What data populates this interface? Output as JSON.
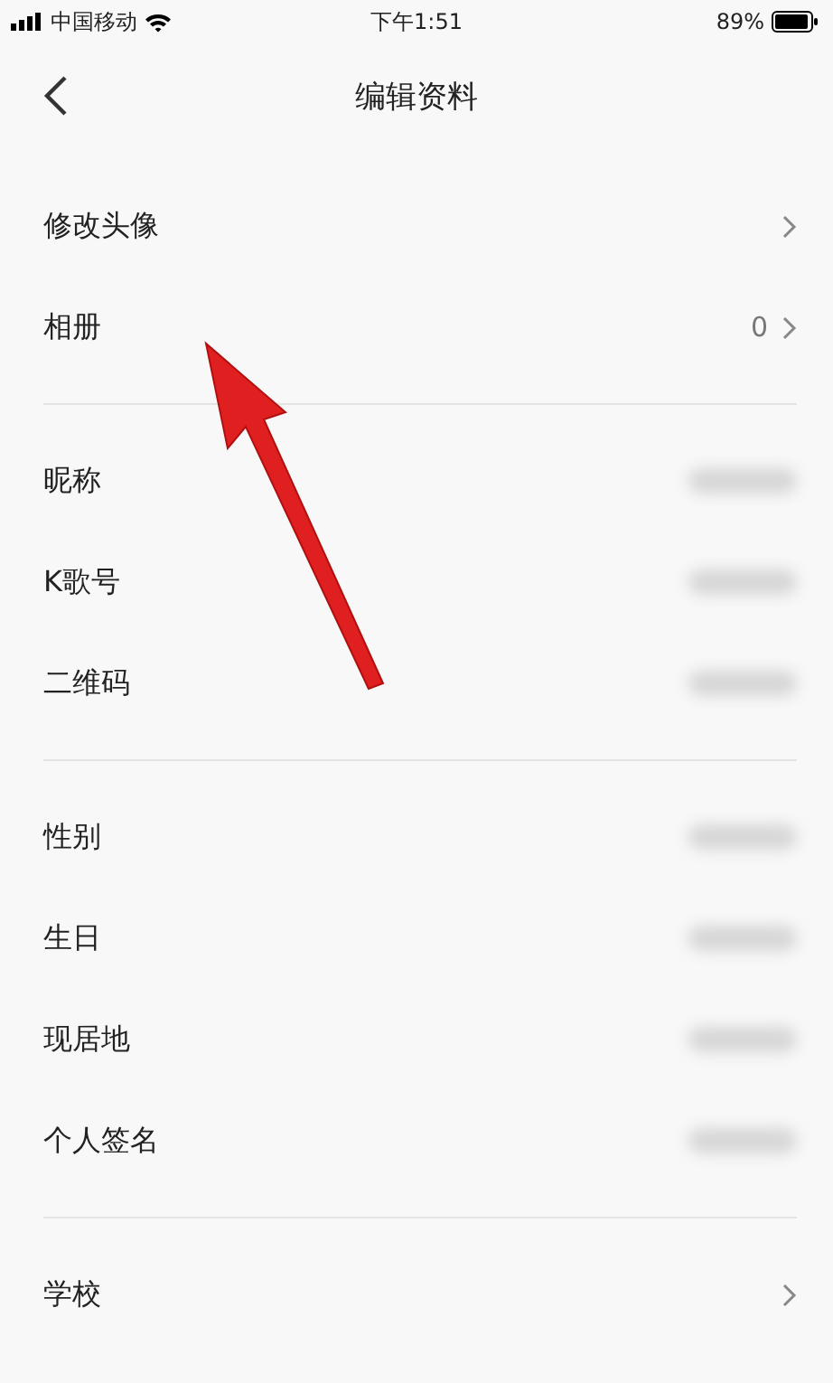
{
  "status_bar": {
    "carrier": "中国移动",
    "time": "下午1:51",
    "battery": "89%"
  },
  "nav": {
    "title": "编辑资料"
  },
  "sections": [
    {
      "rows": [
        {
          "label": "修改头像",
          "kind": "chevron"
        },
        {
          "label": "相册",
          "kind": "count",
          "value": "0"
        }
      ]
    },
    {
      "rows": [
        {
          "label": "昵称",
          "kind": "blurred"
        },
        {
          "label": "K歌号",
          "kind": "blurred"
        },
        {
          "label": "二维码",
          "kind": "blurred"
        }
      ]
    },
    {
      "rows": [
        {
          "label": "性别",
          "kind": "blurred"
        },
        {
          "label": "生日",
          "kind": "blurred"
        },
        {
          "label": "现居地",
          "kind": "blurred"
        },
        {
          "label": "个人签名",
          "kind": "blurred"
        }
      ]
    },
    {
      "rows": [
        {
          "label": "学校",
          "kind": "chevron"
        }
      ]
    }
  ]
}
